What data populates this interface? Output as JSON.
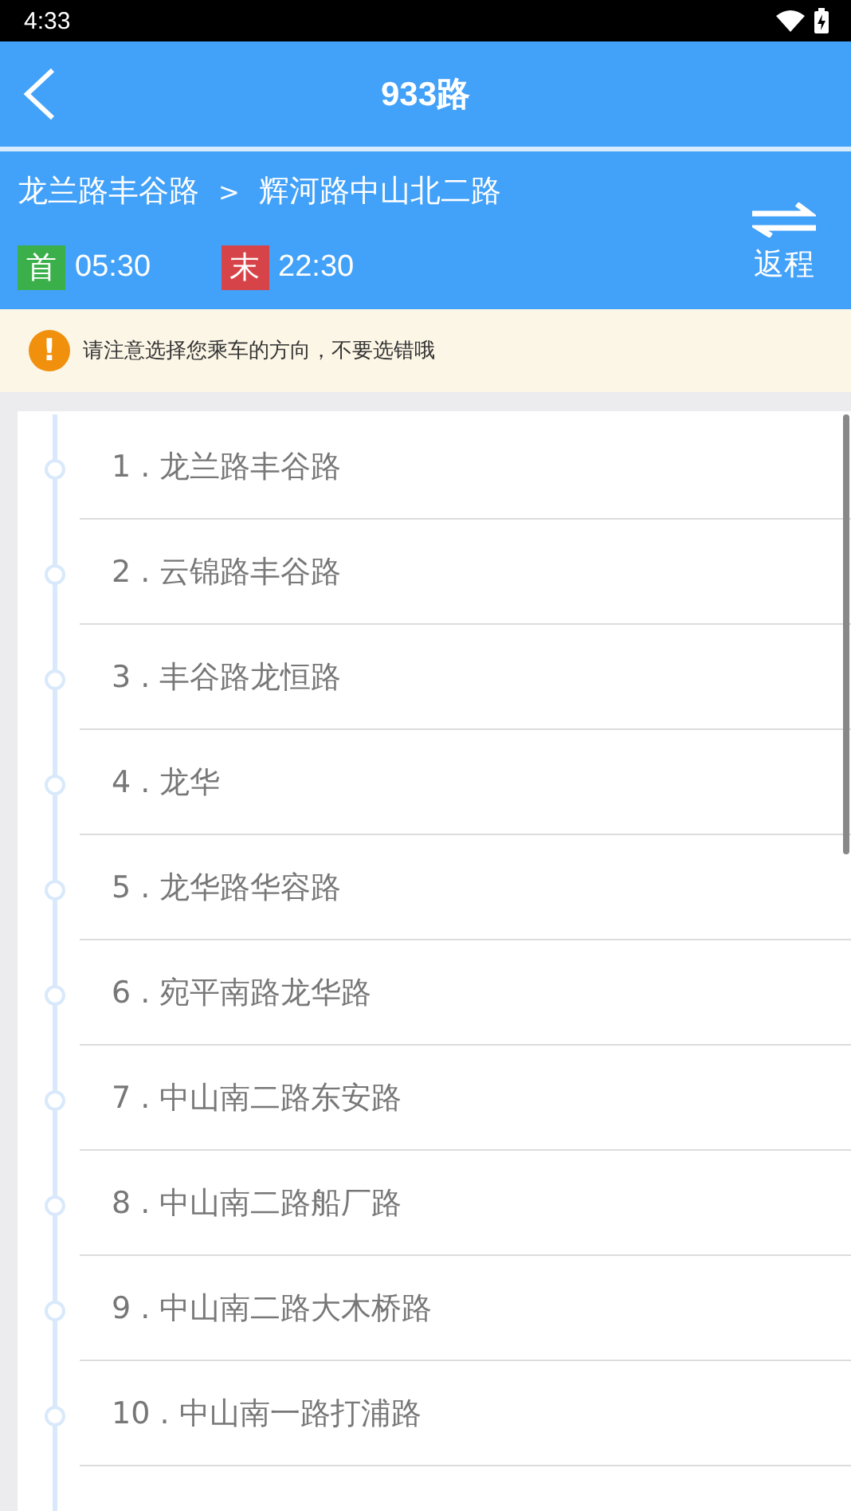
{
  "status_bar": {
    "time": "4:33"
  },
  "header": {
    "title": "933路"
  },
  "route": {
    "from": "龙兰路丰谷路",
    "separator": ">",
    "to": "辉河路中山北二路",
    "first": {
      "badge": "首",
      "time": "05:30"
    },
    "last": {
      "badge": "末",
      "time": "22:30"
    },
    "return_label": "返程"
  },
  "notice": {
    "icon": "!",
    "text": "请注意选择您乘车的方向，不要选错哦"
  },
  "stops": [
    {
      "label": "1 . 龙兰路丰谷路"
    },
    {
      "label": "2 . 云锦路丰谷路"
    },
    {
      "label": "3 . 丰谷路龙恒路"
    },
    {
      "label": "4 . 龙华"
    },
    {
      "label": "5 . 龙华路华容路"
    },
    {
      "label": "6 . 宛平南路龙华路"
    },
    {
      "label": "7 . 中山南二路东安路"
    },
    {
      "label": "8 . 中山南二路船厂路"
    },
    {
      "label": "9 . 中山南二路大木桥路"
    },
    {
      "label": "10 . 中山南一路打浦路"
    }
  ]
}
